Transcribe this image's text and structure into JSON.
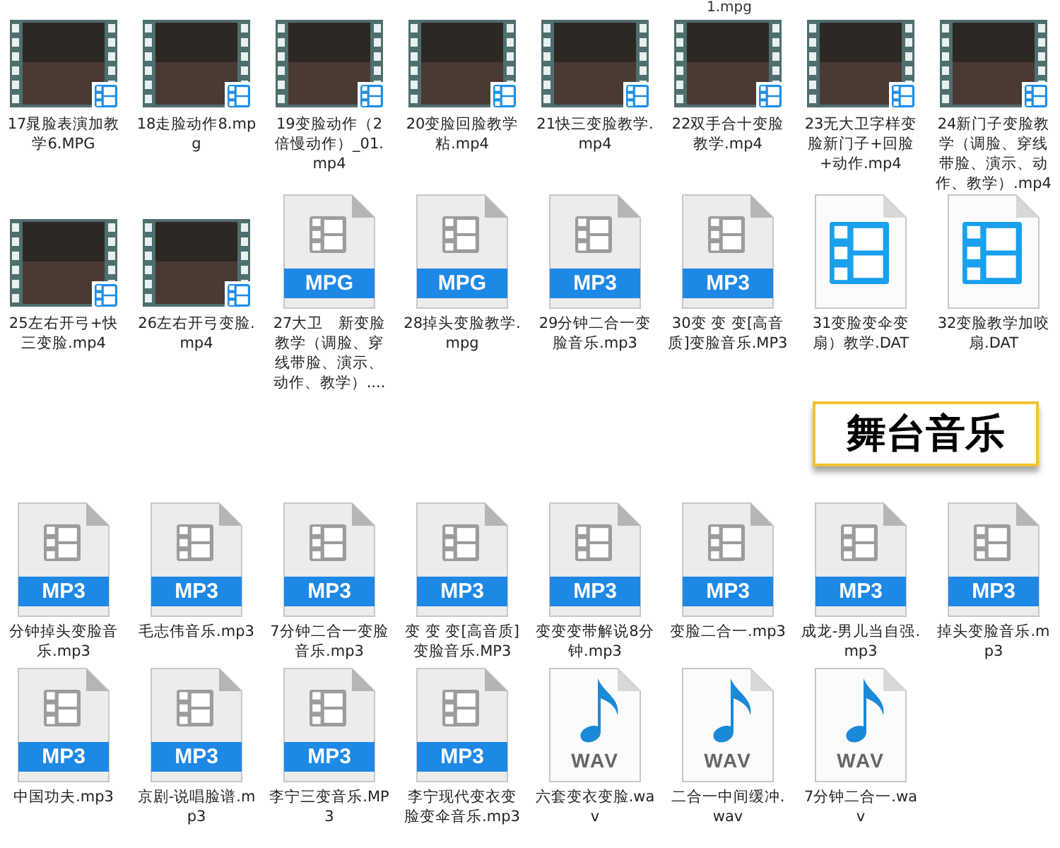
{
  "top_fragment": "1.mpg",
  "groups": [
    {
      "files": [
        {
          "kind": "video",
          "name": "17晁脸表演加教学6.MPG"
        },
        {
          "kind": "video",
          "name": "18走脸动作8.mpg"
        },
        {
          "kind": "video",
          "name": "19变脸动作（2倍慢动作）_01.mp4"
        },
        {
          "kind": "video",
          "name": "20变脸回脸教学粘.mp4"
        },
        {
          "kind": "video",
          "name": "21快三变脸教学.mp4"
        },
        {
          "kind": "video",
          "name": "22双手合十变脸教学.mp4"
        },
        {
          "kind": "video",
          "name": "23无大卫字样变脸新门子+回脸+动作.mp4"
        },
        {
          "kind": "video",
          "name": "24新门子变脸教学（调脸、穿线带脸、演示、动作、教学）.mp4"
        },
        {
          "kind": "video",
          "name": "25左右开弓+快三变脸.mp4"
        },
        {
          "kind": "video",
          "name": "26左右开弓变脸.mp4"
        },
        {
          "kind": "document",
          "label": "MPG",
          "name": "27大卫　新变脸教学（调脸、穿线带脸、演示、动作、教学）...."
        },
        {
          "kind": "document",
          "label": "MPG",
          "name": "28掉头变脸教学.mpg"
        },
        {
          "kind": "document",
          "label": "MP3",
          "name": "29分钟二合一变脸音乐.mp3"
        },
        {
          "kind": "document",
          "label": "MP3",
          "name": "30变 变 变[高音质]变脸音乐.MP3"
        },
        {
          "kind": "dat",
          "name": "31变脸变伞变扇）教学.DAT"
        },
        {
          "kind": "dat",
          "name": "32变脸教学加咬扇.DAT"
        }
      ]
    },
    {
      "heading": "舞台音乐",
      "files": [
        {
          "kind": "document",
          "label": "MP3",
          "name": "分钟掉头变脸音乐.mp3"
        },
        {
          "kind": "document",
          "label": "MP3",
          "name": "毛志伟音乐.mp3"
        },
        {
          "kind": "document",
          "label": "MP3",
          "name": "7分钟二合一变脸音乐.mp3"
        },
        {
          "kind": "document",
          "label": "MP3",
          "name": "变 变 变[高音质]变脸音乐.MP3"
        },
        {
          "kind": "document",
          "label": "MP3",
          "name": "变变变带解说8分钟.mp3"
        },
        {
          "kind": "document",
          "label": "MP3",
          "name": "变脸二合一.mp3"
        },
        {
          "kind": "document",
          "label": "MP3",
          "name": "成龙-男儿当自强.mp3"
        },
        {
          "kind": "document",
          "label": "MP3",
          "name": "掉头变脸音乐.mp3"
        },
        {
          "kind": "document",
          "label": "MP3",
          "name": "中国功夫.mp3"
        },
        {
          "kind": "document",
          "label": "MP3",
          "name": "京剧-说唱脸谱.mp3"
        },
        {
          "kind": "document",
          "label": "MP3",
          "name": "李宁三变音乐.MP3"
        },
        {
          "kind": "document",
          "label": "MP3",
          "name": "李宁现代变衣变脸变伞音乐.mp3"
        },
        {
          "kind": "wav",
          "label": "WAV",
          "name": "六套变衣变脸.wav"
        },
        {
          "kind": "wav",
          "label": "WAV",
          "name": "二合一中间缓冲.wav"
        },
        {
          "kind": "wav",
          "label": "WAV",
          "name": "7分钟二合一.wav"
        }
      ]
    }
  ]
}
